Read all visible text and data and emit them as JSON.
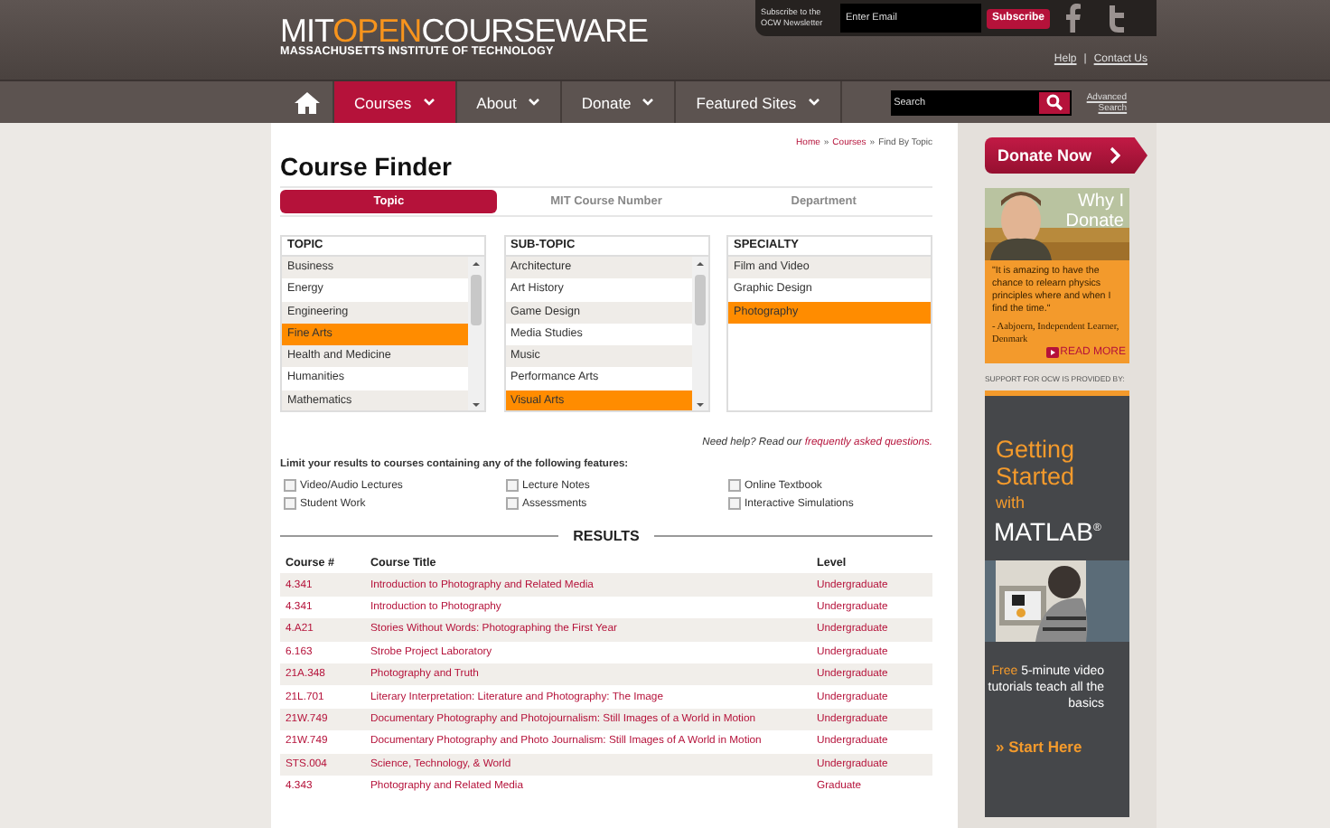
{
  "header": {
    "logo": {
      "first": "MIT",
      "accent": "OPEN",
      "rest": "COURSEWARE",
      "subtitle": "MASSACHUSETTS INSTITUTE OF TECHNOLOGY"
    },
    "newsletter": {
      "label": "Subscribe to the OCW Newsletter",
      "placeholder": "Enter Email",
      "button": "Subscribe"
    },
    "links": [
      "Help",
      "Contact Us"
    ],
    "link_separator": "|"
  },
  "nav": {
    "items": [
      {
        "label": "Courses",
        "selected": true
      },
      {
        "label": "About",
        "selected": false
      },
      {
        "label": "Donate",
        "selected": false
      },
      {
        "label": "Featured Sites",
        "selected": false
      }
    ],
    "search": {
      "placeholder": "Search"
    },
    "advanced": "Advanced Search"
  },
  "breadcrumb": {
    "items": [
      "Home",
      "Courses",
      "Find By Topic"
    ],
    "separator": "»"
  },
  "title": "Course Finder",
  "tabs": [
    {
      "label": "Topic",
      "selected": true
    },
    {
      "label": "MIT Course Number",
      "selected": false
    },
    {
      "label": "Department",
      "selected": false
    }
  ],
  "lists": [
    {
      "heading": "TOPIC",
      "scrollbar": true,
      "items": [
        {
          "label": "Business",
          "selected": false
        },
        {
          "label": "Energy",
          "selected": false
        },
        {
          "label": "Engineering",
          "selected": false
        },
        {
          "label": "Fine Arts",
          "selected": true
        },
        {
          "label": "Health and Medicine",
          "selected": false
        },
        {
          "label": "Humanities",
          "selected": false
        },
        {
          "label": "Mathematics",
          "selected": false
        }
      ]
    },
    {
      "heading": "SUB-TOPIC",
      "scrollbar": true,
      "items": [
        {
          "label": "Architecture",
          "selected": false
        },
        {
          "label": "Art History",
          "selected": false
        },
        {
          "label": "Game Design",
          "selected": false
        },
        {
          "label": "Media Studies",
          "selected": false
        },
        {
          "label": "Music",
          "selected": false
        },
        {
          "label": "Performance Arts",
          "selected": false
        },
        {
          "label": "Visual Arts",
          "selected": true
        }
      ]
    },
    {
      "heading": "SPECIALTY",
      "scrollbar": false,
      "items": [
        {
          "label": "Film and Video",
          "selected": false
        },
        {
          "label": "Graphic Design",
          "selected": false
        },
        {
          "label": "Photography",
          "selected": true
        }
      ]
    }
  ],
  "help": {
    "text": "Need help? Read our",
    "link": "frequently asked questions."
  },
  "features": {
    "intro": "Limit your results to courses containing any of the following features:",
    "options": [
      {
        "label": "Video/Audio Lectures",
        "checked": false
      },
      {
        "label": "Lecture Notes",
        "checked": false
      },
      {
        "label": "Online Textbook",
        "checked": false
      },
      {
        "label": "Student Work",
        "checked": false
      },
      {
        "label": "Assessments",
        "checked": false
      },
      {
        "label": "Interactive Simulations",
        "checked": false
      }
    ]
  },
  "results": {
    "title": "RESULTS",
    "columns": [
      "Course #",
      "Course Title",
      "Level"
    ],
    "rows": [
      [
        "4.341",
        "Introduction to Photography and Related Media",
        "Undergraduate"
      ],
      [
        "4.341",
        "Introduction to Photography",
        "Undergraduate"
      ],
      [
        "4.A21",
        "Stories Without Words: Photographing the First Year",
        "Undergraduate"
      ],
      [
        "6.163",
        "Strobe Project Laboratory",
        "Undergraduate"
      ],
      [
        "21A.348",
        "Photography and Truth",
        "Undergraduate"
      ],
      [
        "21L.701",
        "Literary Interpretation: Literature and Photography: The Image",
        "Undergraduate"
      ],
      [
        "21W.749",
        "Documentary Photography and Photojournalism: Still Images of a World in Motion",
        "Undergraduate"
      ],
      [
        "21W.749",
        "Documentary Photography and Photo Journalism: Still Images of A World in Motion",
        "Undergraduate"
      ],
      [
        "STS.004",
        "Science, Technology, & World",
        "Undergraduate"
      ],
      [
        "4.343",
        "Photography and Related Media",
        "Graduate"
      ]
    ]
  },
  "sidebar": {
    "donate_button": "Donate Now",
    "testimonial": {
      "title": "Why I Donate",
      "quote": "\"It is amazing to have the chance to relearn physics principles where and when I find the time.\"",
      "attribution": "- Aabjoern, Independent Learner, Denmark",
      "read_more": "READ MORE"
    },
    "support_label": "SUPPORT FOR OCW IS PROVIDED BY:",
    "ad": {
      "heading": "Getting Started",
      "with": "with",
      "brand": "MATLAB",
      "mark": "®",
      "highlight": "Free",
      "tagline": "5-minute video tutorials teach all the basics",
      "cta": "» Start Here"
    }
  }
}
